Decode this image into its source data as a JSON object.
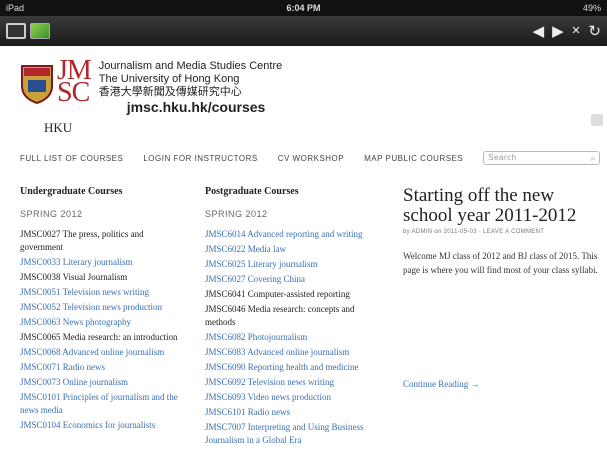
{
  "statusbar": {
    "device": "iPad",
    "time": "6:04 PM",
    "battery": "49%"
  },
  "toolbar": {
    "back": "◀",
    "forward": "▶",
    "close": "×",
    "reload": "↻"
  },
  "header": {
    "jm": "JM",
    "sc": "SC",
    "hku": "HKU",
    "line1": "Journalism and Media Studies Centre",
    "line2": "The University of Hong Kong",
    "line3": "香港大學新聞及傳媒研究中心",
    "url": "jmsc.hku.hk/courses"
  },
  "nav": {
    "items": [
      "FULL LIST OF COURSES",
      "LOGIN FOR INSTRUCTORS",
      "CV WORKSHOP",
      "MAP PUBLIC COURSES"
    ],
    "search_placeholder": "Search"
  },
  "undergrad": {
    "title": "Undergraduate Courses",
    "term": "SPRING 2012",
    "courses": [
      {
        "text": "JMSC0027 The press, politics and government",
        "link": false
      },
      {
        "text": "JMSC0033 Literary journalism",
        "link": true
      },
      {
        "text": "JMSC0038 Visual Journalism",
        "link": false
      },
      {
        "text": "JMSC0051 Television news writing",
        "link": true
      },
      {
        "text": "JMSC0052 Television news production",
        "link": true
      },
      {
        "text": "JMSC0063 News photography",
        "link": true
      },
      {
        "text": "JMSC0065 Media research: an introduction",
        "link": false
      },
      {
        "text": "JMSC0068 Advanced online journalism",
        "link": true
      },
      {
        "text": "JMSC0071 Radio news",
        "link": true
      },
      {
        "text": "JMSC0073 Online journalism",
        "link": true
      },
      {
        "text": "JMSC0101 Principles of journalism and the news media",
        "link": true
      },
      {
        "text": "JMSC0104 Economics for journalists",
        "link": true
      }
    ]
  },
  "postgrad": {
    "title": "Postgraduate Courses",
    "term": "SPRING 2012",
    "courses": [
      {
        "text": "JMSC6014 Advanced reporting and writing",
        "link": true
      },
      {
        "text": "JMSC6022 Media law",
        "link": true
      },
      {
        "text": "JMSC6025 Literary journalism",
        "link": true
      },
      {
        "text": "JMSC6027 Covering China",
        "link": true
      },
      {
        "text": "JMSC6041 Computer-assisted reporting",
        "link": false
      },
      {
        "text": "JMSC6046 Media research: concepts and methods",
        "link": false
      },
      {
        "text": "JMSC6082 Photojournalism",
        "link": true
      },
      {
        "text": "JMSC6083 Advanced online journalism",
        "link": true
      },
      {
        "text": "JMSC6090 Reporting health and medicine",
        "link": true
      },
      {
        "text": "JMSC6092 Television news writing",
        "link": true
      },
      {
        "text": "JMSC6093 Video news production",
        "link": true
      },
      {
        "text": "JMSC6101 Radio news",
        "link": true
      },
      {
        "text": "JMSC7007 Interpreting and Using Business Journalism in a Global Era",
        "link": true
      }
    ]
  },
  "post": {
    "title": "Starting off the new school year 2011-2012",
    "meta": "by ADMIN on 2011-05-03 · LEAVE A COMMENT",
    "body": "Welcome MJ class of 2012 and BJ class of 2015. This page is where you will find most of your class syllabi.",
    "more": "Continue Reading →"
  }
}
